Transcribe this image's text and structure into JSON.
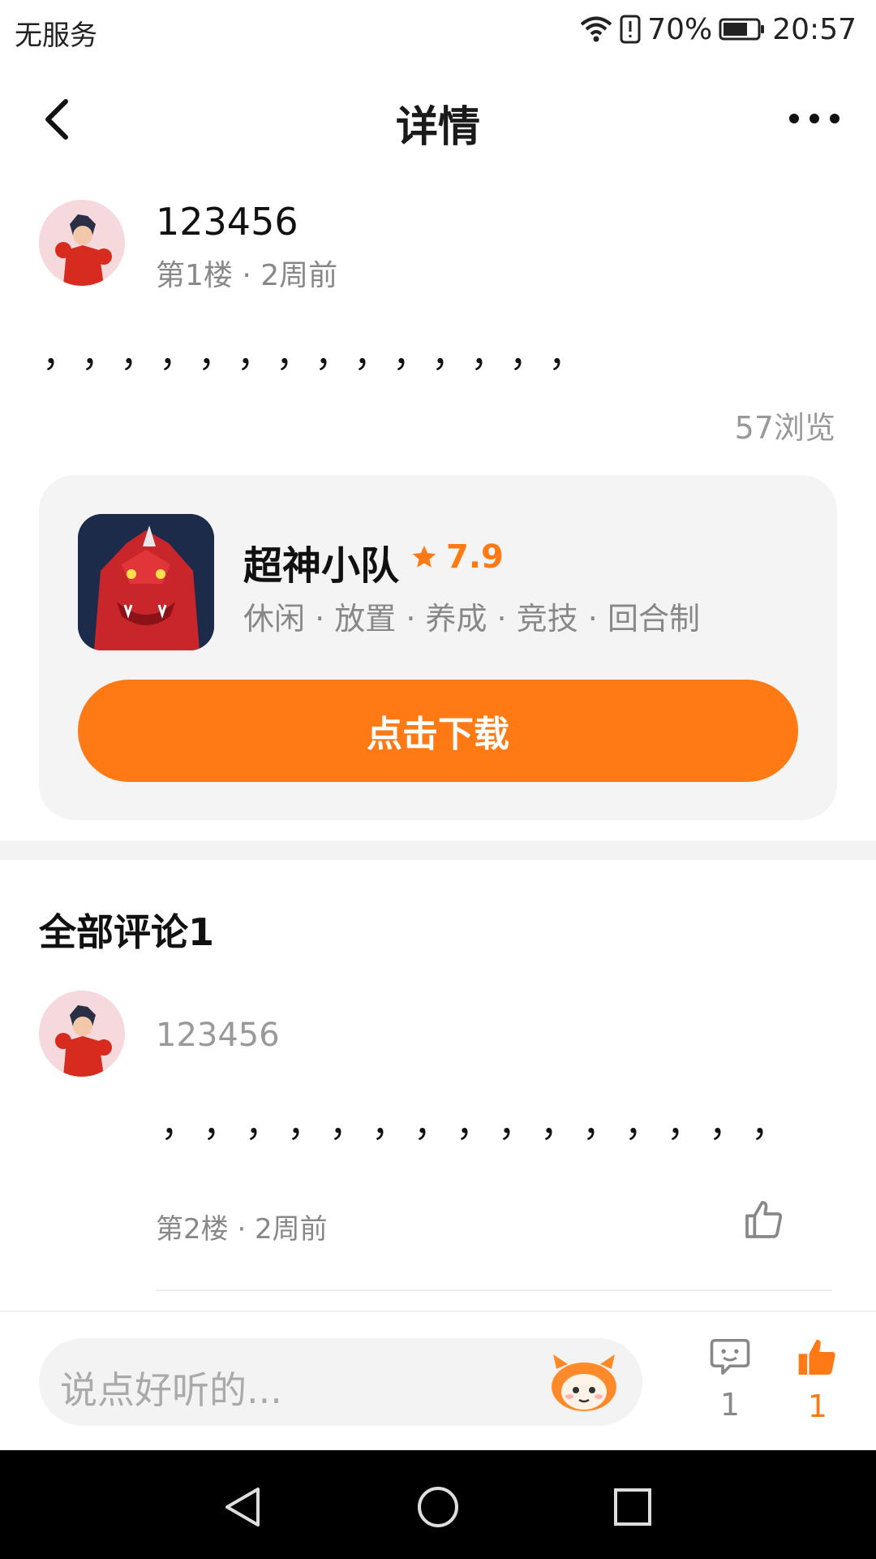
{
  "status_bar": {
    "carrier": "无服务",
    "battery": "70%",
    "time": "20:57"
  },
  "header": {
    "title": "详情"
  },
  "post": {
    "author": "123456",
    "meta": "第1楼 · 2周前",
    "content": "，，，，，，，，，，，，，，",
    "views": "57浏览"
  },
  "game": {
    "name": "超神小队",
    "rating": "7.9",
    "tags": "休闲 · 放置 · 养成 · 竞技 · 回合制",
    "download_label": "点击下载"
  },
  "comments": {
    "title": "全部评论1",
    "items": [
      {
        "author": "123456",
        "content": "，，，，，，，，，，，，，，，",
        "meta": "第2楼 · 2周前"
      }
    ]
  },
  "bottom_bar": {
    "placeholder": "说点好听的...",
    "comment_count": "1",
    "like_count": "1"
  },
  "colors": {
    "accent": "#ff7a14",
    "muted": "#888888",
    "card_bg": "#f4f4f4"
  },
  "icons": [
    "wifi-icon",
    "alert-icon",
    "battery-icon",
    "back-icon",
    "more-icon",
    "star-icon",
    "like-icon",
    "comment-icon",
    "mascot-icon",
    "nav-back-icon",
    "nav-home-icon",
    "nav-recents-icon"
  ]
}
